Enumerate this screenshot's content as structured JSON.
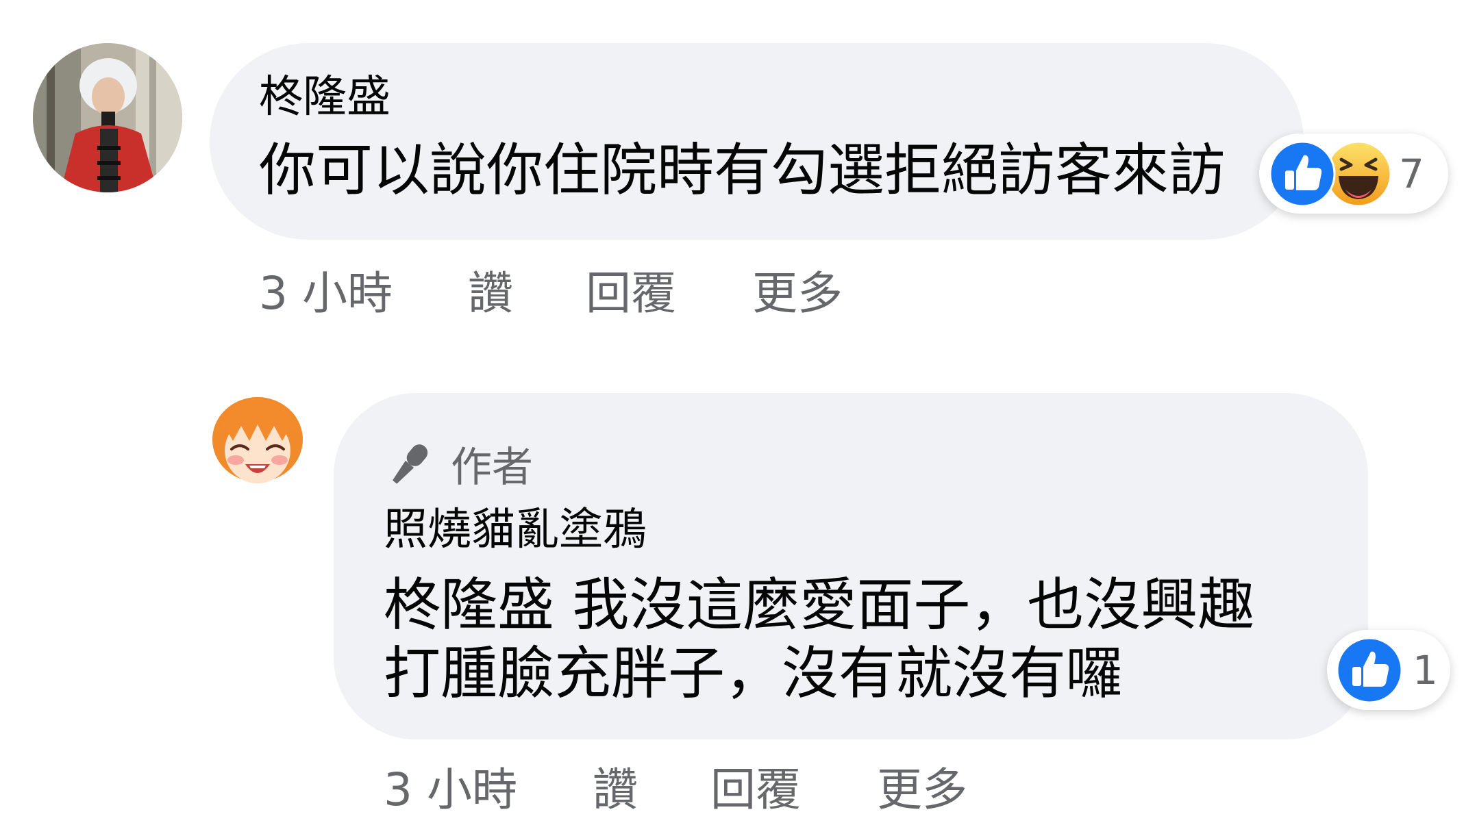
{
  "comments": [
    {
      "author": "柊隆盛",
      "text": "你可以說你住院時有勾選拒絕訪客來訪",
      "reaction_count": "7",
      "reactions": [
        "like-icon",
        "haha-icon"
      ],
      "actions": {
        "time": "3 小時",
        "like": "讚",
        "reply": "回覆",
        "more": "更多"
      }
    },
    {
      "badge": "作者",
      "author": "照燒貓亂塗鴉",
      "text_line1": "柊隆盛 我沒這麼愛面子，也沒興趣",
      "text_line2": "打腫臉充胖子，沒有就沒有囉",
      "reaction_count": "1",
      "reactions": [
        "like-icon"
      ],
      "actions": {
        "time": "3 小時",
        "like": "讚",
        "reply": "回覆",
        "more": "更多"
      }
    }
  ],
  "colors": {
    "bubble": "#f0f2f5",
    "secondary_text": "#65676b",
    "like_blue": "#1877f2",
    "haha_yellow": "#f7b125"
  }
}
